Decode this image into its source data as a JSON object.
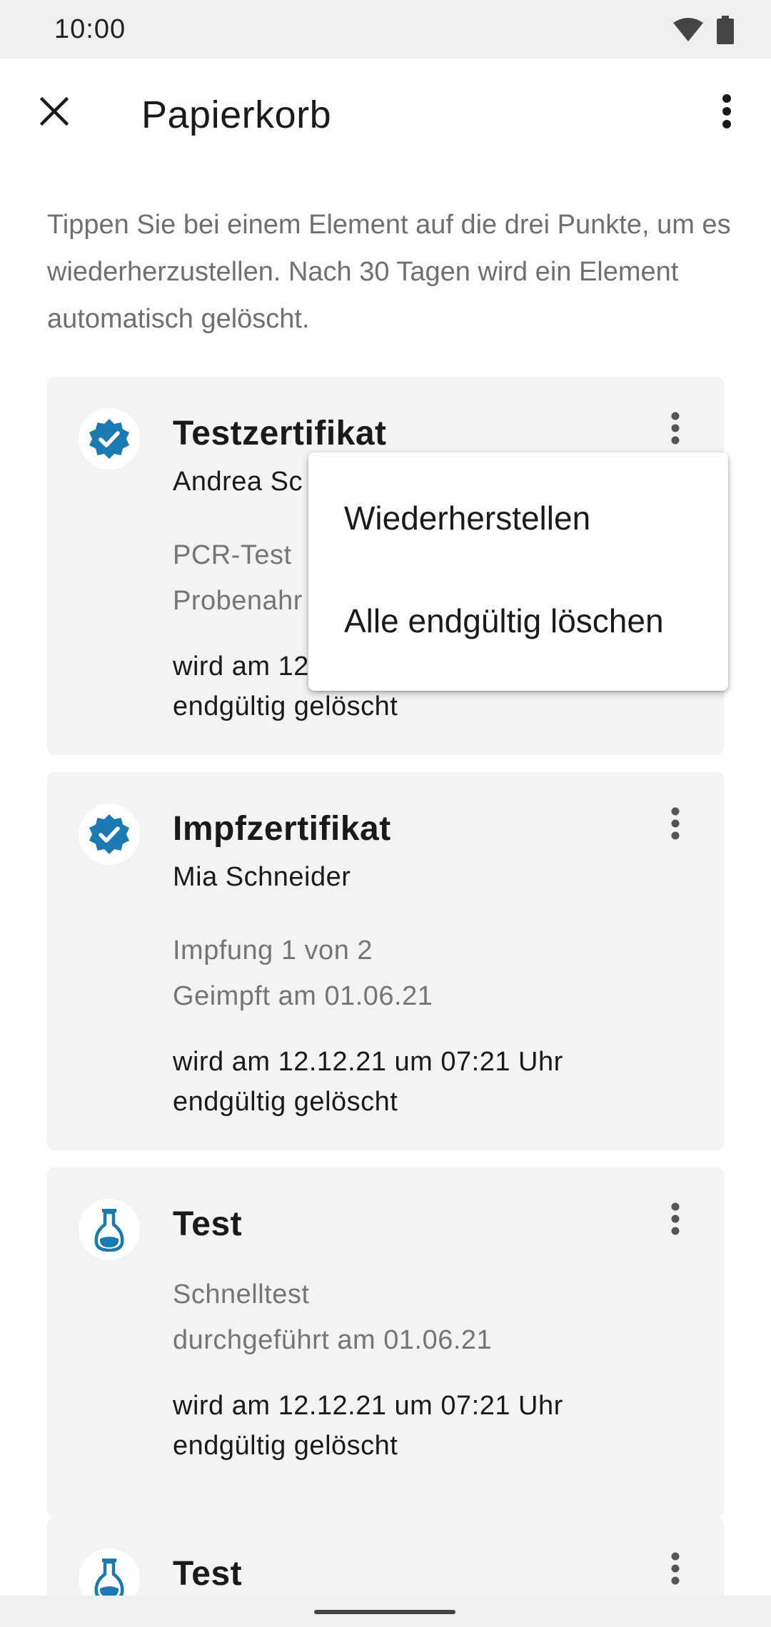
{
  "status_bar": {
    "time": "10:00",
    "icons": [
      "wifi-icon",
      "battery-icon"
    ]
  },
  "toolbar": {
    "title": "Papierkorb",
    "close_icon": "close-icon",
    "overflow_icon": "more-vert-icon"
  },
  "intro": "Tippen Sie bei einem Element auf die drei Punkte, um es wiederherzustellen. Nach 30 Tagen wird ein Element automatisch gelöscht.",
  "colors": {
    "accent": "#1a7ab1",
    "card_bg": "#f3f3f3",
    "secondary_text": "#757575"
  },
  "cards": [
    {
      "icon": "verified-badge-icon",
      "title": "Testzertifikat",
      "name": "Andrea Sc",
      "meta1": "PCR-Test",
      "meta2": "Probenahr",
      "note1": "wird am 12",
      "note2": "endgültig gelöscht"
    },
    {
      "icon": "verified-badge-icon",
      "title": "Impfzertifikat",
      "name": "Mia Schneider",
      "meta1": "Impfung 1 von 2",
      "meta2": "Geimpft am 01.06.21",
      "note1": "wird am 12.12.21 um 07:21 Uhr",
      "note2": "endgültig gelöscht"
    },
    {
      "icon": "flask-icon",
      "title": "Test",
      "meta1": "Schnelltest",
      "meta2": "durchgeführt am 01.06.21",
      "note1": "wird am 12.12.21 um 07:21 Uhr",
      "note2": "endgültig gelöscht"
    },
    {
      "icon": "flask-icon",
      "title": "Test"
    }
  ],
  "menu": {
    "items": [
      "Wiederherstellen",
      "Alle endgültig löschen"
    ]
  }
}
